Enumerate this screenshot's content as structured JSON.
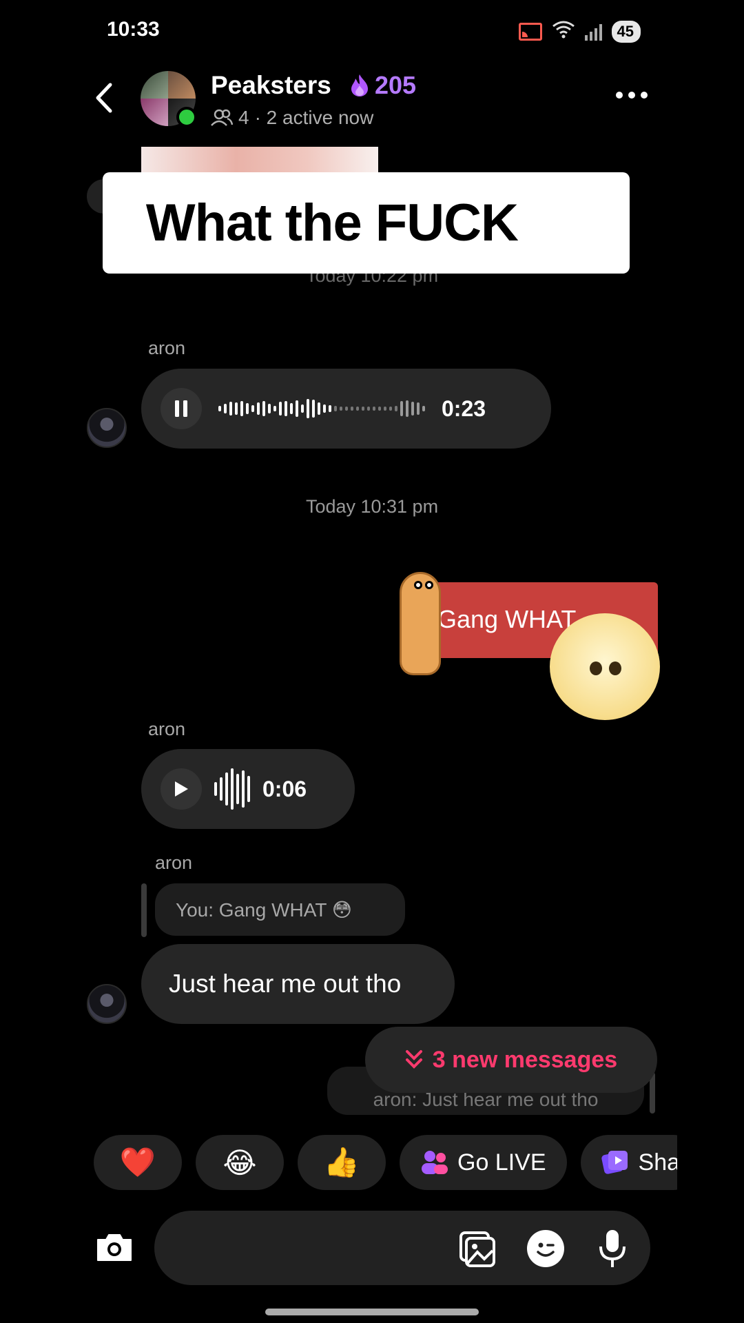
{
  "status_bar": {
    "time": "10:33",
    "battery": "45",
    "icons": [
      "cast-icon",
      "wifi-icon",
      "signal-icon",
      "battery-icon"
    ]
  },
  "header": {
    "group_name": "Peaksters",
    "streak_icon": "flame-icon",
    "streak_count": "205",
    "member_count": "4",
    "active_status": "· 2 active now",
    "accent_color": "#b57aff"
  },
  "caption_overlay": {
    "text": "What the FUCK",
    "emoji": "😒"
  },
  "chat": {
    "partial_timestamp": "Today 10:22 pm",
    "messages": [
      {
        "type": "voice",
        "sender": "aron",
        "state": "playing",
        "duration": "0:23",
        "progress": 0.55
      },
      {
        "type": "timestamp",
        "text": "Today 10:31 pm"
      },
      {
        "type": "sticker",
        "sender": "You",
        "text": "Gang WHAT"
      },
      {
        "type": "voice",
        "sender": "aron",
        "state": "paused",
        "duration": "0:06"
      },
      {
        "type": "text",
        "sender": "aron",
        "reply_to": "You: Gang WHAT 😳",
        "text": "Just hear me out tho"
      },
      {
        "type": "own_reply_partial",
        "reply_to": "aron: Just hear me out tho"
      }
    ]
  },
  "new_messages": {
    "label": "3 new messages",
    "color": "#ff3a6e"
  },
  "quick_actions": [
    {
      "kind": "emoji",
      "value": "❤️",
      "name": "heart-reaction"
    },
    {
      "kind": "emoji",
      "value": "😂",
      "name": "laugh-reaction"
    },
    {
      "kind": "emoji",
      "value": "👍",
      "name": "thumbs-up-reaction"
    },
    {
      "kind": "action",
      "label": "Go LIVE",
      "icon": "people-icon"
    },
    {
      "kind": "action",
      "label": "Sha",
      "icon": "share-icon"
    }
  ],
  "composer": {
    "placeholder": "",
    "icons": [
      "camera-icon",
      "gallery-icon",
      "sticker-icon",
      "mic-icon"
    ]
  }
}
